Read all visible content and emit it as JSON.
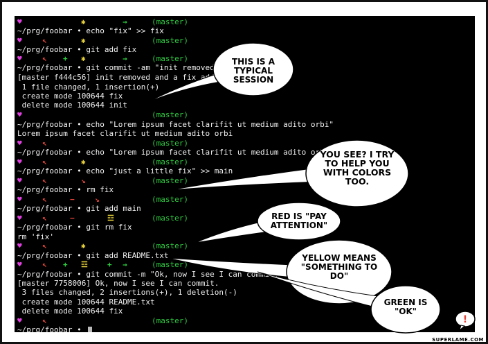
{
  "branch_label": "(master)",
  "colors": {
    "green": "#2ecc40",
    "red": "#e8463b",
    "yellow": "#e8d23a",
    "magenta": "#e040e0",
    "white": "#f2f2f2"
  },
  "terminal_lines": [
    {
      "text": "~/prg/foobar • echo \"fix\" >> fix"
    },
    {
      "text": "~/prg/foobar • git add fix"
    },
    {
      "text": "~/prg/foobar • git commit -am \"init removed and a fix added\""
    },
    {
      "text": "[master f444c56] init removed and a fix added"
    },
    {
      "text": " 1 file changed, 1 insertion(+)"
    },
    {
      "text": " create mode 100644 fix"
    },
    {
      "text": " delete mode 100644 init"
    },
    {
      "text": "~/prg/foobar • echo \"Lorem ipsum facet clarifit ut medium adito orbi\""
    },
    {
      "text": "Lorem ipsum facet clarifit ut medium adito orbi"
    },
    {
      "text": "~/prg/foobar • echo \"Lorem ipsum facet clarifit ut medium adito orbi\" >> main"
    },
    {
      "text": "~/prg/foobar • echo \"just a little fix\" >> main"
    },
    {
      "text": "~/prg/foobar • rm fix"
    },
    {
      "text": "~/prg/foobar • git add main"
    },
    {
      "text": "~/prg/foobar • git rm fix"
    },
    {
      "text": "rm 'fix'"
    },
    {
      "text": "~/prg/foobar • git add README.txt"
    },
    {
      "text": "~/prg/foobar • git commit -m \"Ok, now I see I can commit.\""
    },
    {
      "text": "[master 7758006] Ok, now I see I can commit."
    },
    {
      "text": " 3 files changed, 2 insertions(+), 1 deletion(-)"
    },
    {
      "text": " create mode 100644 README.txt"
    },
    {
      "text": " delete mode 100644 fix"
    },
    {
      "text": "~/prg/foobar • "
    }
  ],
  "bubbles": [
    {
      "text": "THIS IS A TYPICAL SESSION"
    },
    {
      "text": "YOU SEE? I TRY TO HELP YOU WITH COLORS TOO."
    },
    {
      "text": "RED IS \"PAY ATTENTION\""
    },
    {
      "text": "YELLOW MEANS \"SOMETHING TO DO\""
    },
    {
      "text": "GREEN IS \"OK\""
    }
  ],
  "credit": "SUPERLAME.COM"
}
